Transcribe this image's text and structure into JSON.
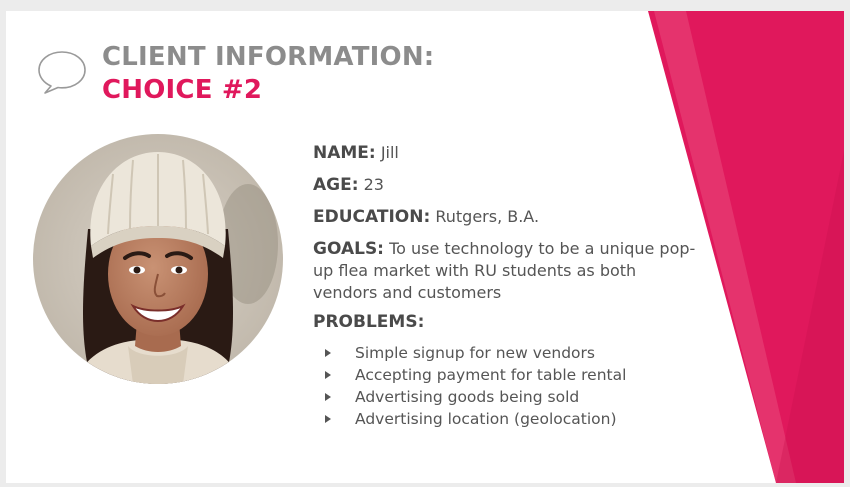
{
  "slide": {
    "title_line1": "CLIENT INFORMATION:",
    "title_line2": "CHOICE #2",
    "icon": "speech-bubble-icon",
    "accent_color": "#e0185c",
    "title_gray": "#8c8c8c"
  },
  "client": {
    "name_label": "NAME:",
    "name_value": "Jill",
    "age_label": "AGE:",
    "age_value": "23",
    "education_label": "EDUCATION:",
    "education_value": "Rutgers, B.A.",
    "goals_label": "GOALS:",
    "goals_value": "To use technology to be a unique pop-up flea market with RU students as both vendors and customers",
    "problems_label": "PROBLEMS:",
    "problems": [
      "Simple signup for new vendors",
      "Accepting payment for table rental",
      "Advertising goods being sold",
      "Advertising location (geolocation)"
    ]
  },
  "photo": {
    "icon": "client-portrait-photo"
  }
}
